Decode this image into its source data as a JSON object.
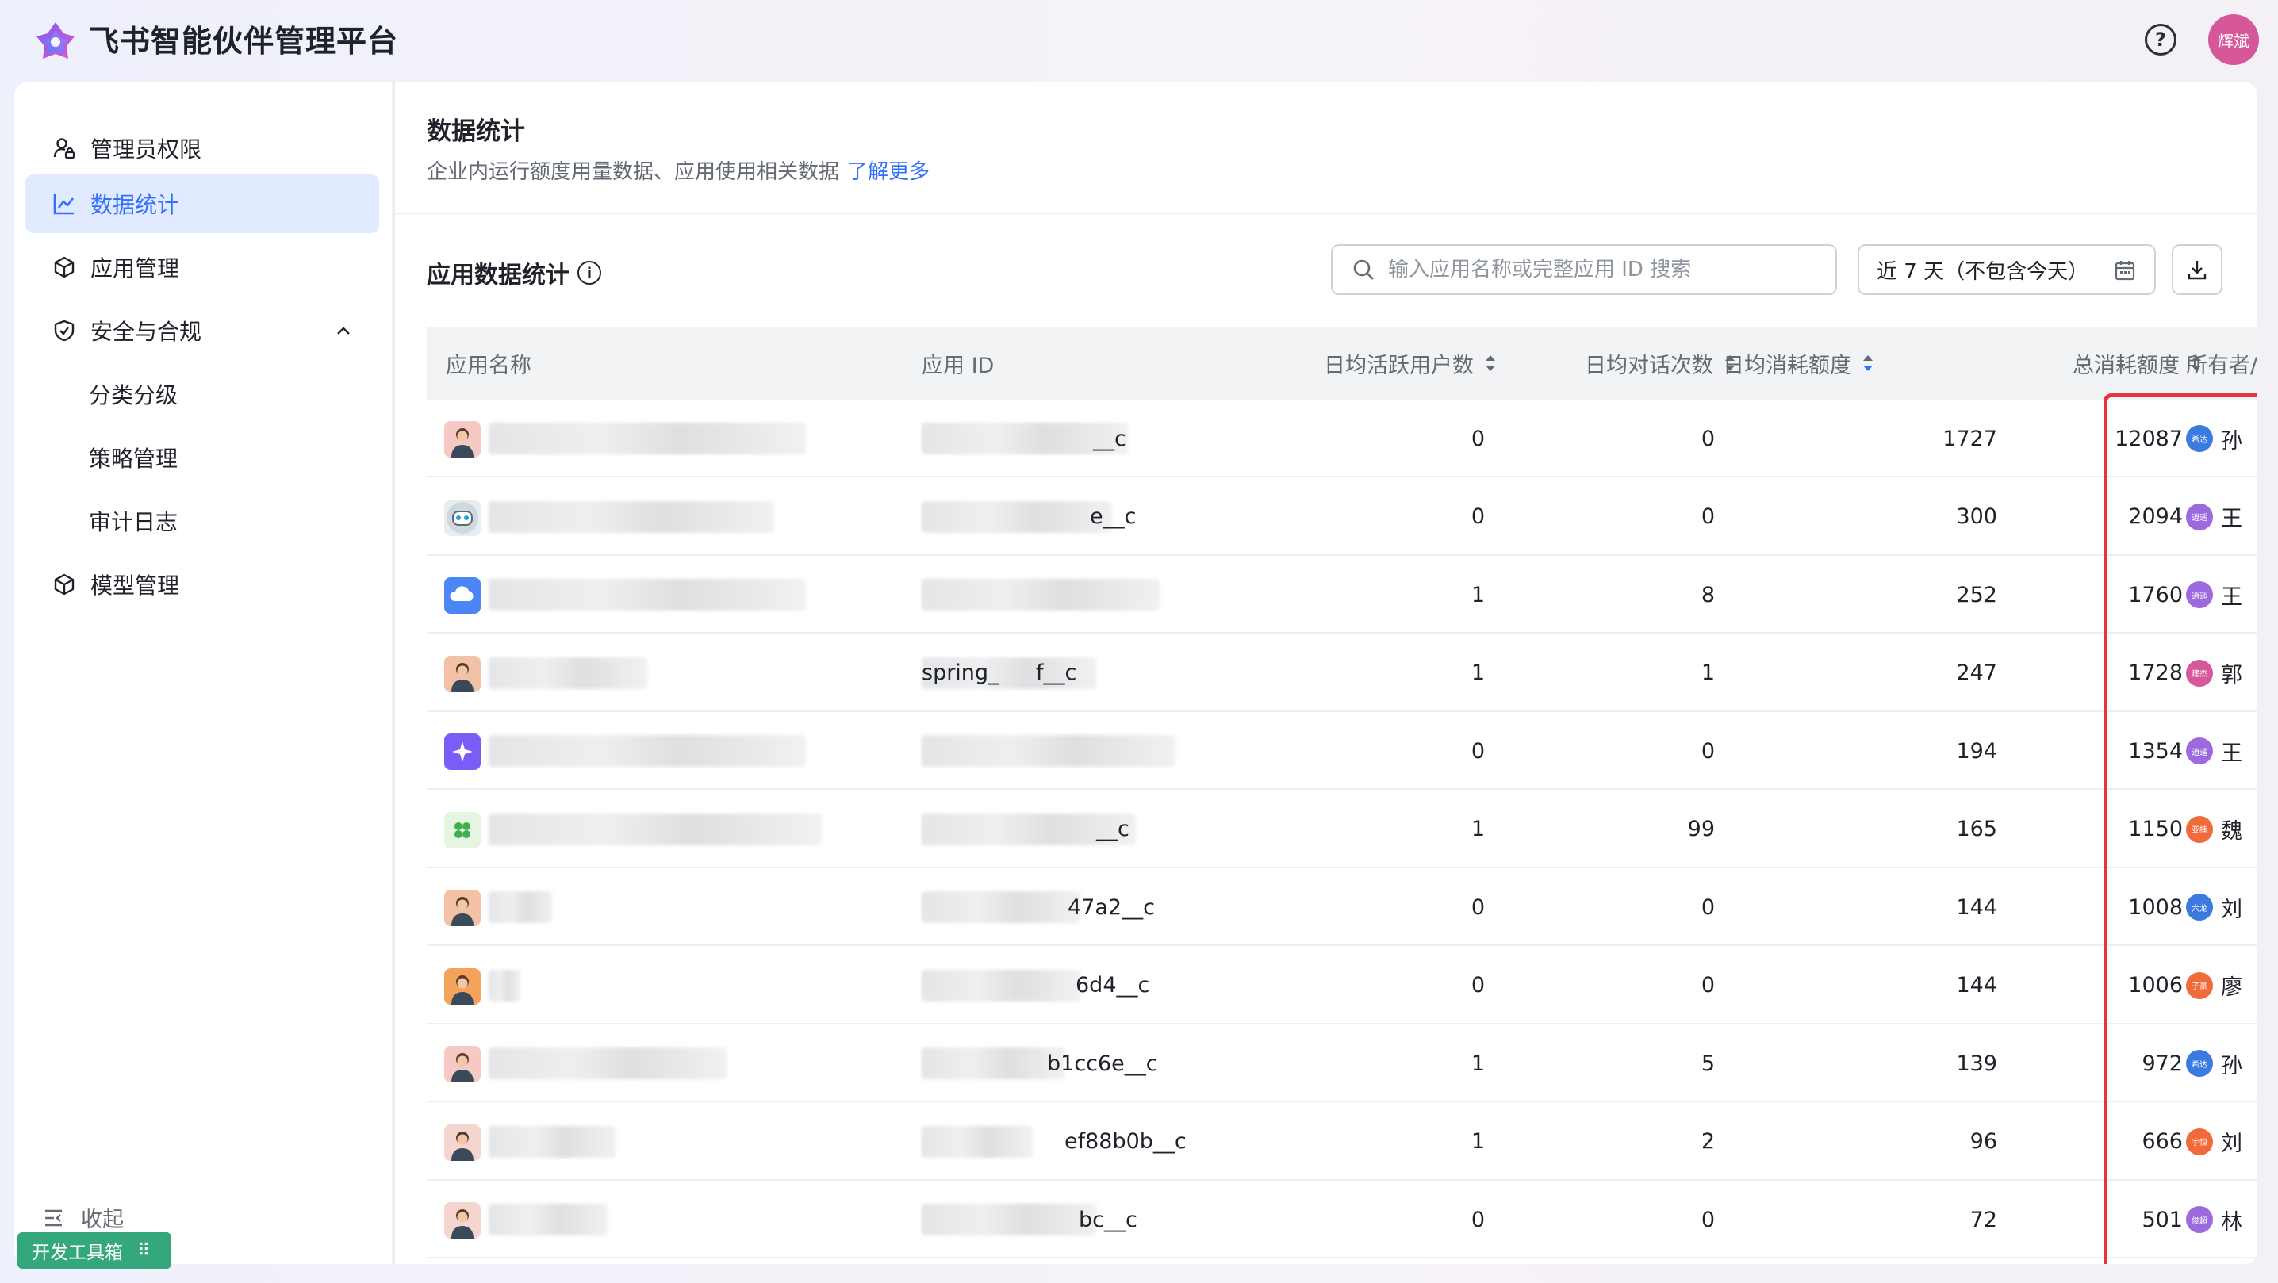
{
  "header": {
    "title": "飞书智能伙伴管理平台",
    "help_icon": "question-circle-icon",
    "user_avatar": "辉斌"
  },
  "sidebar": {
    "items": [
      {
        "label": "管理员权限",
        "icon": "user-lock-icon"
      },
      {
        "label": "数据统计",
        "icon": "line-chart-icon"
      },
      {
        "label": "应用管理",
        "icon": "cube-icon"
      },
      {
        "label": "安全与合规",
        "icon": "shield-check-icon"
      },
      {
        "label": "分类分级"
      },
      {
        "label": "策略管理"
      },
      {
        "label": "审计日志"
      },
      {
        "label": "模型管理",
        "icon": "cube-icon"
      }
    ],
    "collapse_label": "收起",
    "devtools_label": "开发工具箱"
  },
  "page": {
    "title": "数据统计",
    "description": "企业内运行额度用量数据、应用使用相关数据",
    "learn_more": "了解更多"
  },
  "section": {
    "title": "应用数据统计",
    "search_placeholder": "输入应用名称或完整应用 ID 搜索",
    "date_range": "近 7 天（不包含今天）"
  },
  "table": {
    "columns": [
      "应用名称",
      "应用 ID",
      "日均活跃用户数",
      "日均对话次数",
      "日均消耗额度",
      "总消耗额度",
      "所有者/"
    ],
    "rows": [
      {
        "id_suffix": "__c",
        "dau": "0",
        "dialogs": "0",
        "daily_cost": "1727",
        "total_cost": "12087",
        "owner_badge": "希达",
        "owner_name": "孙",
        "badge_color": "#3b7be0"
      },
      {
        "id_suffix": "e__c",
        "dau": "0",
        "dialogs": "0",
        "daily_cost": "300",
        "total_cost": "2094",
        "owner_badge": "逍遥",
        "owner_name": "王",
        "badge_color": "#9c6ade"
      },
      {
        "id_suffix": "",
        "dau": "1",
        "dialogs": "8",
        "daily_cost": "252",
        "total_cost": "1760",
        "owner_badge": "逍遥",
        "owner_name": "王",
        "badge_color": "#9c6ade"
      },
      {
        "id_suffix": "f__c",
        "id_prefix": "spring_",
        "dau": "1",
        "dialogs": "1",
        "daily_cost": "247",
        "total_cost": "1728",
        "owner_badge": "建杰",
        "owner_name": "郭",
        "badge_color": "#d6579a"
      },
      {
        "id_suffix": "",
        "dau": "0",
        "dialogs": "0",
        "daily_cost": "194",
        "total_cost": "1354",
        "owner_badge": "逍遥",
        "owner_name": "王",
        "badge_color": "#9c6ade"
      },
      {
        "id_suffix": "__c",
        "dau": "1",
        "dialogs": "99",
        "daily_cost": "165",
        "total_cost": "1150",
        "owner_badge": "亚楠",
        "owner_name": "魏",
        "badge_color": "#f06a3b"
      },
      {
        "id_suffix": "47a2__c",
        "dau": "0",
        "dialogs": "0",
        "daily_cost": "144",
        "total_cost": "1008",
        "owner_badge": "六龙",
        "owner_name": "刘",
        "badge_color": "#3b7be0"
      },
      {
        "id_suffix": "6d4__c",
        "dau": "0",
        "dialogs": "0",
        "daily_cost": "144",
        "total_cost": "1006",
        "owner_badge": "子豪",
        "owner_name": "廖",
        "badge_color": "#f06a3b"
      },
      {
        "id_suffix": "b1cc6e__c",
        "dau": "1",
        "dialogs": "5",
        "daily_cost": "139",
        "total_cost": "972",
        "owner_badge": "希达",
        "owner_name": "孙",
        "badge_color": "#3b7be0"
      },
      {
        "id_suffix": "ef88b0b__c",
        "dau": "1",
        "dialogs": "2",
        "daily_cost": "96",
        "total_cost": "666",
        "owner_badge": "宇恒",
        "owner_name": "刘",
        "badge_color": "#f06a3b"
      },
      {
        "id_suffix": "bc__c",
        "dau": "0",
        "dialogs": "0",
        "daily_cost": "72",
        "total_cost": "501",
        "owner_badge": "俊超",
        "owner_name": "林",
        "badge_color": "#9c6ade"
      }
    ]
  },
  "colors": {
    "accent": "#3370ff",
    "highlight": "#e5343d",
    "devtools": "#34a77d"
  }
}
